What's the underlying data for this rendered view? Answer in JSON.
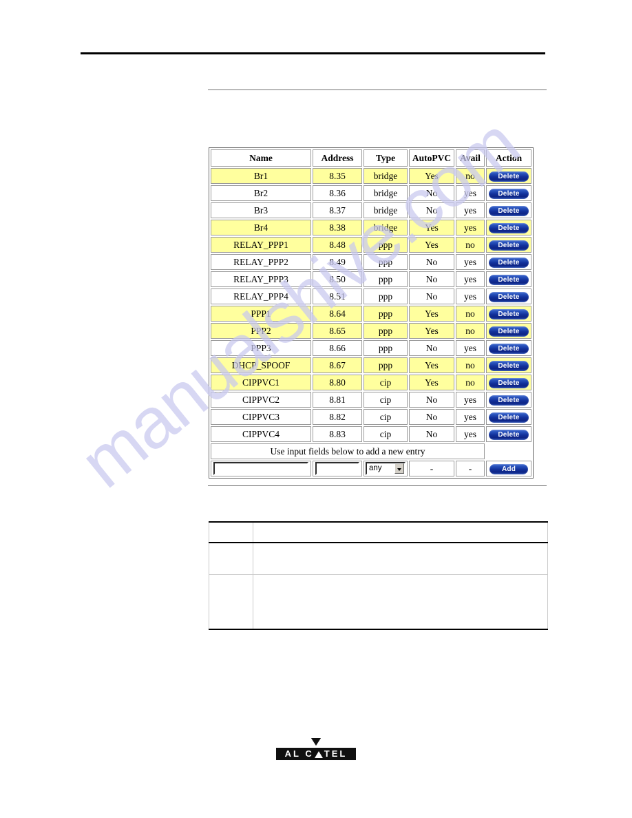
{
  "page": {
    "footer_logo": {
      "brand": "ALCATEL",
      "letters_before": "AL C",
      "letters_after": "TEL",
      "triangle_down_icon": "triangle-down-icon",
      "triangle_up_icon": "triangle-up-icon"
    },
    "watermark": "manualshive.com"
  },
  "config_table": {
    "columns": [
      "Name",
      "Address",
      "Type",
      "AutoPVC",
      "Avail",
      "Action"
    ],
    "rows": [
      {
        "name": "Br1",
        "address": "8.35",
        "type": "bridge",
        "autopvc": "Yes",
        "avail": "no",
        "action": "Delete",
        "highlighted": true
      },
      {
        "name": "Br2",
        "address": "8.36",
        "type": "bridge",
        "autopvc": "No",
        "avail": "yes",
        "action": "Delete",
        "highlighted": false
      },
      {
        "name": "Br3",
        "address": "8.37",
        "type": "bridge",
        "autopvc": "No",
        "avail": "yes",
        "action": "Delete",
        "highlighted": false
      },
      {
        "name": "Br4",
        "address": "8.38",
        "type": "bridge",
        "autopvc": "Yes",
        "avail": "yes",
        "action": "Delete",
        "highlighted": true
      },
      {
        "name": "RELAY_PPP1",
        "address": "8.48",
        "type": "ppp",
        "autopvc": "Yes",
        "avail": "no",
        "action": "Delete",
        "highlighted": true
      },
      {
        "name": "RELAY_PPP2",
        "address": "8.49",
        "type": "ppp",
        "autopvc": "No",
        "avail": "yes",
        "action": "Delete",
        "highlighted": false
      },
      {
        "name": "RELAY_PPP3",
        "address": "8.50",
        "type": "ppp",
        "autopvc": "No",
        "avail": "yes",
        "action": "Delete",
        "highlighted": false
      },
      {
        "name": "RELAY_PPP4",
        "address": "8.51",
        "type": "ppp",
        "autopvc": "No",
        "avail": "yes",
        "action": "Delete",
        "highlighted": false
      },
      {
        "name": "PPP1",
        "address": "8.64",
        "type": "ppp",
        "autopvc": "Yes",
        "avail": "no",
        "action": "Delete",
        "highlighted": true
      },
      {
        "name": "PPP2",
        "address": "8.65",
        "type": "ppp",
        "autopvc": "Yes",
        "avail": "no",
        "action": "Delete",
        "highlighted": true
      },
      {
        "name": "PPP3",
        "address": "8.66",
        "type": "ppp",
        "autopvc": "No",
        "avail": "yes",
        "action": "Delete",
        "highlighted": false
      },
      {
        "name": "DHCP_SPOOF",
        "address": "8.67",
        "type": "ppp",
        "autopvc": "Yes",
        "avail": "no",
        "action": "Delete",
        "highlighted": true
      },
      {
        "name": "CIPPVC1",
        "address": "8.80",
        "type": "cip",
        "autopvc": "Yes",
        "avail": "no",
        "action": "Delete",
        "highlighted": true
      },
      {
        "name": "CIPPVC2",
        "address": "8.81",
        "type": "cip",
        "autopvc": "No",
        "avail": "yes",
        "action": "Delete",
        "highlighted": false
      },
      {
        "name": "CIPPVC3",
        "address": "8.82",
        "type": "cip",
        "autopvc": "No",
        "avail": "yes",
        "action": "Delete",
        "highlighted": false
      },
      {
        "name": "CIPPVC4",
        "address": "8.83",
        "type": "cip",
        "autopvc": "No",
        "avail": "yes",
        "action": "Delete",
        "highlighted": false
      }
    ],
    "note_row": "Use input fields below to add a new entry",
    "add_form": {
      "name_value": "",
      "name_placeholder": "",
      "address_value": "",
      "address_placeholder": "",
      "type_selected": "any",
      "type_options": [
        "any"
      ],
      "autopvc_value": "-",
      "avail_value": "-",
      "add_label": "Add"
    },
    "colors": {
      "highlight_row": "#ffff9e",
      "button_blue": "#12309a",
      "border": "#9a9a9a"
    }
  },
  "lower_table": {
    "header": [
      "",
      ""
    ],
    "rows": [
      [
        "",
        ""
      ],
      [
        "",
        ""
      ]
    ]
  }
}
